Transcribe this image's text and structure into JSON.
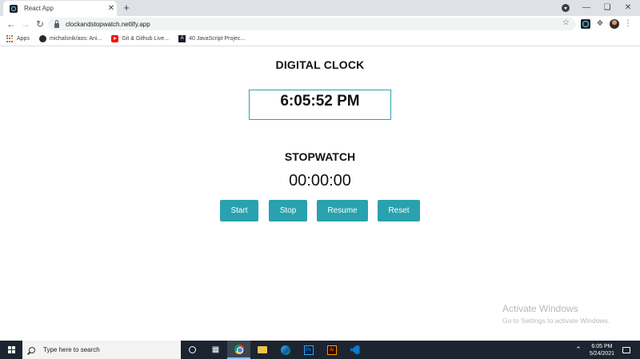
{
  "browser": {
    "tab_title": "React App",
    "tab_close": "✕",
    "new_tab": "+",
    "url": "clockandstopwatch.netlify.app",
    "bookmarks": [
      {
        "label": "Apps"
      },
      {
        "label": "michalsnik/aos: Ani..."
      },
      {
        "label": "Git & Github Live..."
      },
      {
        "label": "40 JavaScript Projec..."
      }
    ]
  },
  "clock": {
    "title": "DIGITAL CLOCK",
    "time": "6:05:52 PM"
  },
  "stopwatch": {
    "title": "STOPWATCH",
    "time": "00:00:00",
    "buttons": {
      "start": "Start",
      "stop": "Stop",
      "resume": "Resume",
      "reset": "Reset"
    }
  },
  "watermark": {
    "line1": "Activate Windows",
    "line2": "Go to Settings to activate Windows."
  },
  "taskbar": {
    "search_placeholder": "Type here to search",
    "time": "6:05 PM",
    "date": "5/24/2021"
  },
  "colors": {
    "accent": "#2aa1ae",
    "text": "#111111"
  }
}
